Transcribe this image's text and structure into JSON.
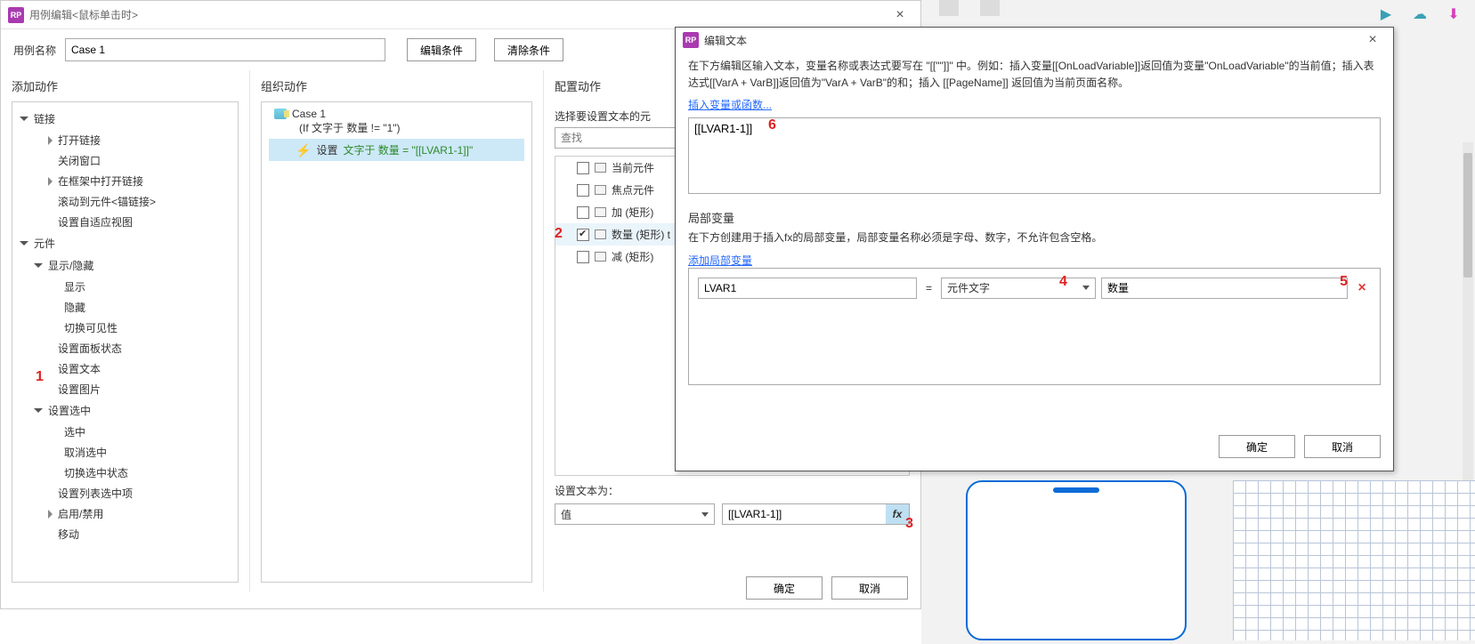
{
  "case_editor": {
    "title": "用例编辑<鼠标单击时>",
    "name_label": "用例名称",
    "name_value": "Case 1",
    "btn_edit_cond": "编辑条件",
    "btn_clear_cond": "清除条件"
  },
  "panels": {
    "add_action": "添加动作",
    "organize": "组织动作",
    "configure": "配置动作"
  },
  "action_tree": {
    "link_group": "链接",
    "open_link": "打开链接",
    "close_window": "关闭窗口",
    "open_in_frame": "在框架中打开链接",
    "scroll_anchor": "滚动到元件<锚链接>",
    "set_viewport": "设置自适应视图",
    "widget_group": "元件",
    "show_hide_group": "显示/隐藏",
    "show": "显示",
    "hide": "隐藏",
    "toggle_vis": "切换可见性",
    "panel_state": "设置面板状态",
    "set_text": "设置文本",
    "set_image": "设置图片",
    "set_selected_group": "设置选中",
    "select": "选中",
    "deselect": "取消选中",
    "toggle_select": "切换选中状态",
    "set_list_item": "设置列表选中项",
    "enable_disable": "启用/禁用",
    "move": "移动"
  },
  "organize": {
    "case_name": "Case 1",
    "if_cond": "(If 文字于 数量 != \"1\")",
    "action_prefix": "设置",
    "action_rest": "文字于 数量 = \"[[LVAR1-1]]\""
  },
  "target": {
    "select_label": "选择要设置文本的元",
    "search_placeholder": "查找",
    "items": {
      "current": "当前元件",
      "focus": "焦点元件",
      "plus": "加 (矩形)",
      "qty": "数量 (矩形) t",
      "minus": "减 (矩形)"
    },
    "set_text_label": "设置文本为：",
    "select_value": "值",
    "text_value": "[[LVAR1-1]]"
  },
  "footer": {
    "ok": "确定",
    "cancel": "取消"
  },
  "edit_text": {
    "title": "编辑文本",
    "desc": "在下方编辑区输入文本，变量名称或表达式要写在 \"[[\"\"]]\" 中。例如：插入变量[[OnLoadVariable]]返回值为变量\"OnLoadVariable\"的当前值；插入表达式[[VarA + VarB]]返回值为\"VarA + VarB\"的和；插入 [[PageName]] 返回值为当前页面名称。",
    "insert_link": "插入变量或函数...",
    "expression": "[[LVAR1-1]]",
    "local_title": "局部变量",
    "local_desc": "在下方创建用于插入fx的局部变量，局部变量名称必须是字母、数字，不允许包含空格。",
    "add_local": "添加局部变量",
    "var_name": "LVAR1",
    "var_source": "元件文字",
    "var_target": "数量"
  },
  "ann": {
    "a1": "1",
    "a2": "2",
    "a3": "3",
    "a4": "4",
    "a5": "5",
    "a6": "6"
  }
}
